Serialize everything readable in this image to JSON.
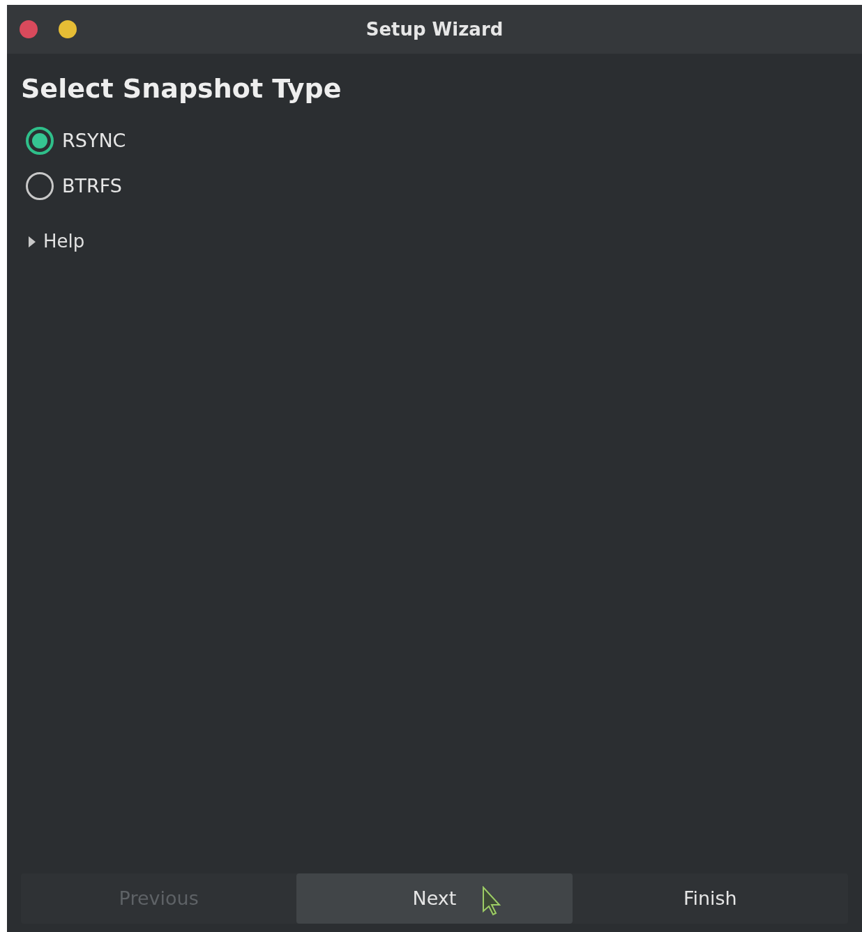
{
  "window": {
    "title": "Setup Wizard",
    "controls": [
      {
        "color": "#d94a5c"
      },
      {
        "color": "#e6bd35"
      }
    ]
  },
  "heading": "Select Snapshot Type",
  "options": [
    {
      "label": "RSYNC",
      "selected": true
    },
    {
      "label": "BTRFS",
      "selected": false
    }
  ],
  "help": {
    "label": "Help",
    "expanded": false
  },
  "buttons": [
    {
      "label": "Previous",
      "disabled": true,
      "hovered": false
    },
    {
      "label": "Next",
      "disabled": false,
      "hovered": true
    },
    {
      "label": "Finish",
      "disabled": false,
      "hovered": false
    }
  ]
}
